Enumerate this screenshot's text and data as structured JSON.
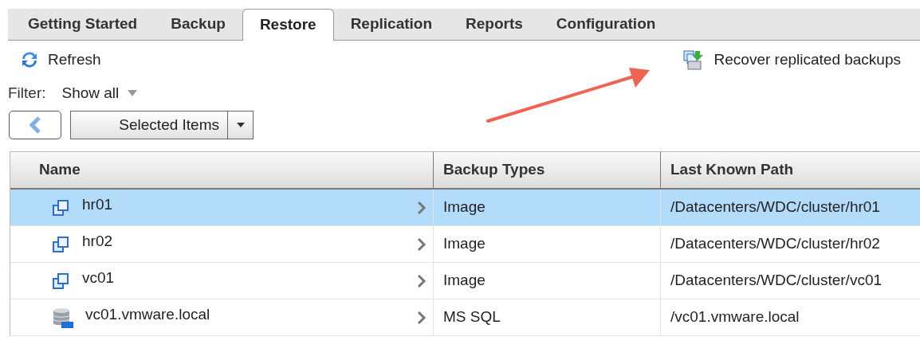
{
  "tabs": [
    {
      "label": "Getting Started",
      "selected": false
    },
    {
      "label": "Backup",
      "selected": false
    },
    {
      "label": "Restore",
      "selected": true
    },
    {
      "label": "Replication",
      "selected": false
    },
    {
      "label": "Reports",
      "selected": false
    },
    {
      "label": "Configuration",
      "selected": false
    }
  ],
  "toolbar": {
    "refresh": "Refresh",
    "recover": "Recover replicated backups"
  },
  "filter": {
    "label": "Filter:",
    "value": "Show all"
  },
  "view_button": "Selected Items",
  "table": {
    "columns": [
      "Name",
      "Backup Types",
      "Last Known Path"
    ],
    "rows": [
      {
        "kind": "vm",
        "name": "hr01",
        "type": "Image",
        "path": "/Datacenters/WDC/cluster/hr01",
        "selected": true
      },
      {
        "kind": "vm",
        "name": "hr02",
        "type": "Image",
        "path": "/Datacenters/WDC/cluster/hr02",
        "selected": false
      },
      {
        "kind": "vm",
        "name": "vc01",
        "type": "Image",
        "path": "/Datacenters/WDC/cluster/vc01",
        "selected": false
      },
      {
        "kind": "database",
        "name": "vc01.vmware.local",
        "type": "MS SQL",
        "path": "/vc01.vmware.local",
        "selected": false
      }
    ]
  }
}
